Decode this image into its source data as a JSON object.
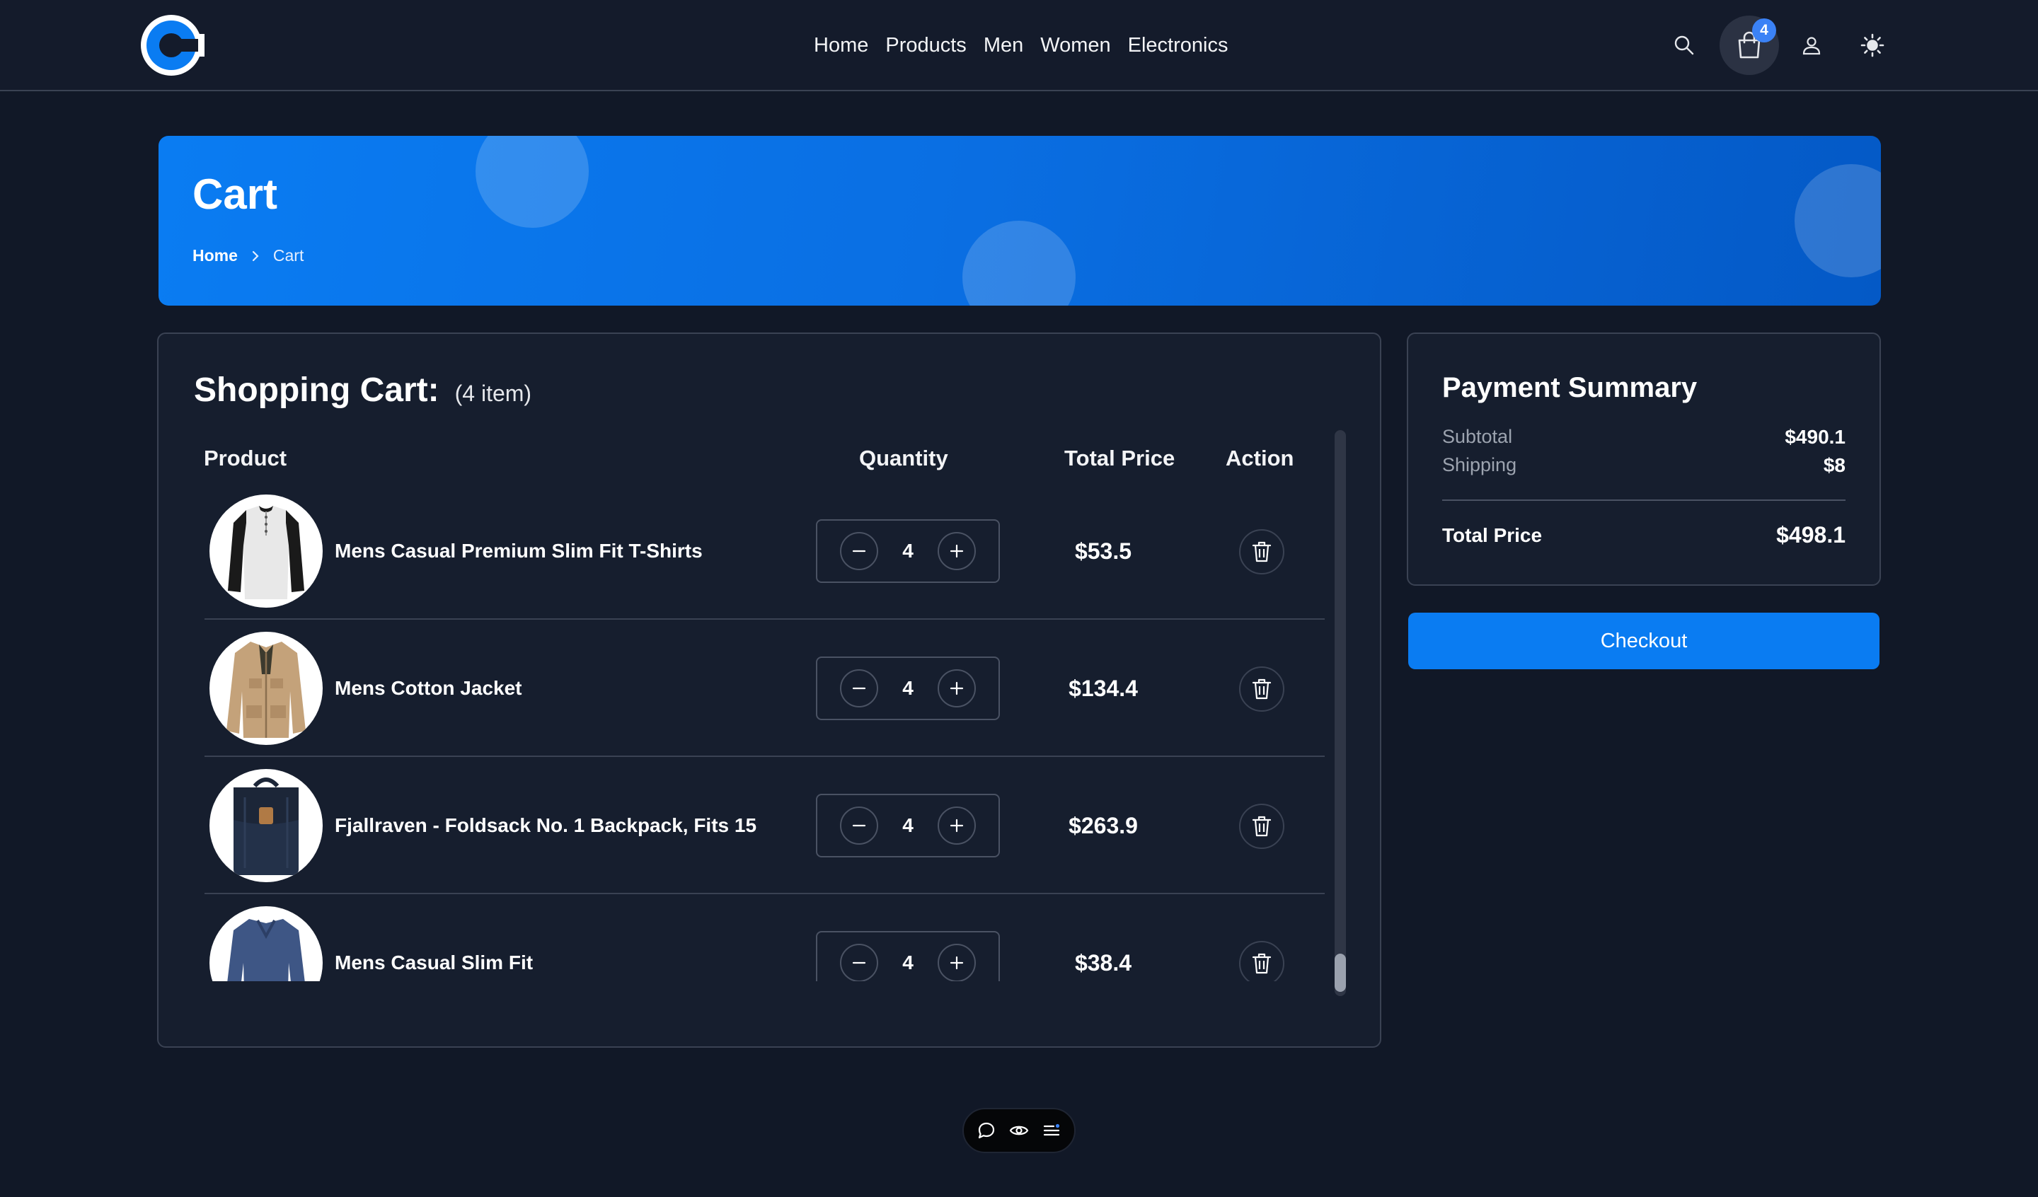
{
  "header": {
    "logo_letter": "C",
    "nav": [
      "Home",
      "Products",
      "Men",
      "Women",
      "Electronics"
    ],
    "cart_count": "4",
    "icons": [
      "search-icon",
      "shopping-bag-icon",
      "user-icon",
      "sun-icon"
    ]
  },
  "banner": {
    "title": "Cart",
    "breadcrumb": {
      "home": "Home",
      "current": "Cart"
    }
  },
  "cart": {
    "title": "Shopping Cart:",
    "count_text": "(4 item)",
    "columns": {
      "product": "Product",
      "quantity": "Quantity",
      "total_price": "Total Price",
      "action": "Action"
    },
    "items": [
      {
        "name": "Mens Casual Premium Slim Fit T-Shirts",
        "quantity": "4",
        "total": "$53.5",
        "image": "henley-shirt"
      },
      {
        "name": "Mens Cotton Jacket",
        "quantity": "4",
        "total": "$134.4",
        "image": "cotton-jacket"
      },
      {
        "name": "Fjallraven - Foldsack No. 1 Backpack, Fits 15 ...",
        "quantity": "4",
        "total": "$263.9",
        "image": "navy-backpack"
      },
      {
        "name": "Mens Casual Slim Fit",
        "quantity": "4",
        "total": "$38.4",
        "image": "blue-longsleeve"
      }
    ],
    "scroll_position": 0.95
  },
  "summary": {
    "title": "Payment Summary",
    "subtotal_label": "Subtotal",
    "subtotal": "$490.1",
    "shipping_label": "Shipping",
    "shipping": "$8",
    "total_label": "Total Price",
    "total": "$498.1"
  },
  "checkout_label": "Checkout",
  "floating_toolbar": [
    "chat-icon",
    "eye-icon",
    "menu-icon"
  ],
  "colors": {
    "background": "#111827",
    "header": "#141b2b",
    "accent": "#0a7cf2",
    "badge": "#3b82f6",
    "panel_border": "#3a4253"
  }
}
